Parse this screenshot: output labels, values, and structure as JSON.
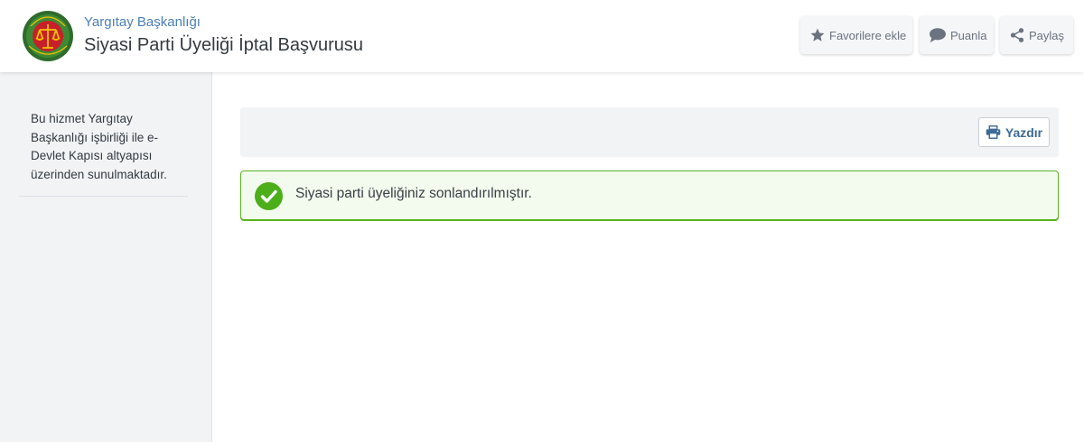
{
  "header": {
    "org_name": "Yargıtay Başkanlığı",
    "service_title": "Siyasi Parti Üyeliği İptal Başvurusu",
    "logo_icon": "yargitay-seal-icon",
    "actions": {
      "favorite_label": "Favorilere ekle",
      "favorite_icon": "star-icon",
      "rate_label": "Puanla",
      "rate_icon": "speech-bubble-icon",
      "share_label": "Paylaş",
      "share_icon": "share-icon"
    }
  },
  "sidebar": {
    "note": "Bu hizmet Yargıtay Başkanlığı işbirliği ile e-Devlet Kapısı altyapısı üzerinden sunulmaktadır."
  },
  "toolbar": {
    "print_label": "Yazdır",
    "print_icon": "printer-icon"
  },
  "alert": {
    "type": "success",
    "message": "Siyasi parti üyeliğiniz sonlandırılmıştır.",
    "icon": "check-circle-icon"
  },
  "colors": {
    "link": "#4a7fb8",
    "success_border": "#59b21e",
    "success_bg": "#f2fbee",
    "print_text": "#3d6a96"
  }
}
